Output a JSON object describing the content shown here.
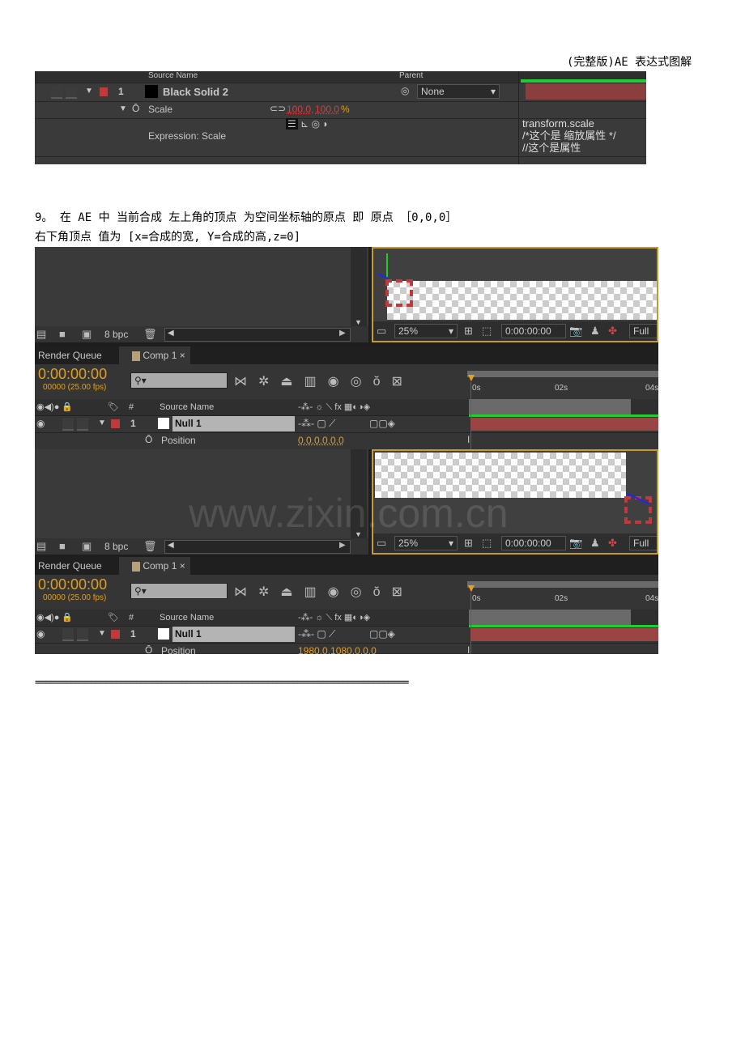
{
  "header": "(完整版)AE 表达式图解",
  "shot1": {
    "columns": {
      "source_name": "Source Name",
      "parent": "Parent"
    },
    "layer": {
      "index": "1",
      "name": "Black Solid 2",
      "parent": "None"
    },
    "property": {
      "name": "Scale",
      "value_x": "100.0",
      "value_y": "100.0",
      "unit": "%"
    },
    "expression": {
      "label": "Expression: Scale",
      "code": [
        "transform.scale",
        "/*这个是 缩放属性 */",
        "//这个是属性"
      ]
    }
  },
  "text": {
    "line1": "9。 在 AE 中 当前合成 左上角的顶点 为空间坐标轴的原点 即 原点 ［0,0,0］",
    "line2": "右下角顶点 值为 [x=合成的宽, Y=合成的高,z=0]"
  },
  "panels": [
    {
      "bpc": "8 bpc",
      "zoom": "25%",
      "viewer_time": "0:00:00:00",
      "resolution": "Full",
      "tabs": [
        "Render Queue",
        "Comp 1"
      ],
      "timecode": "0:00:00:00",
      "frames": "00000 (25.00 fps)",
      "columns": {
        "index": "#",
        "source_name": "Source Name"
      },
      "ruler": [
        "0s",
        "02s",
        "04s"
      ],
      "layer": {
        "index": "1",
        "name": "Null 1"
      },
      "property": {
        "name": "Position",
        "value": "0.0,0.0,0.0"
      }
    },
    {
      "bpc": "8 bpc",
      "zoom": "25%",
      "viewer_time": "0:00:00:00",
      "resolution": "Full",
      "tabs": [
        "Render Queue",
        "Comp 1"
      ],
      "timecode": "0:00:00:00",
      "frames": "00000 (25.00 fps)",
      "columns": {
        "index": "#",
        "source_name": "Source Name"
      },
      "ruler": [
        "0s",
        "02s",
        "04s"
      ],
      "layer": {
        "index": "1",
        "name": "Null 1"
      },
      "property": {
        "name": "Position",
        "value": "1980.0,1080.0,0.0"
      }
    }
  ],
  "watermark": "www.zixin.com.cn",
  "separator": "==========================================================================",
  "colors": {
    "timecode": "#e0a020",
    "layer_bar": "#9a4444",
    "label_red": "#c0393b",
    "work_area": "#22cc33"
  }
}
